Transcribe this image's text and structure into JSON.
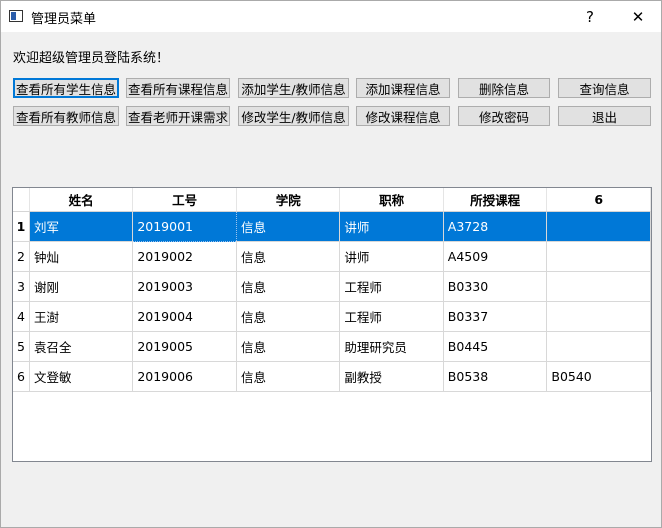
{
  "window": {
    "title": "管理员菜单",
    "help": "?",
    "close": "✕"
  },
  "welcome": "欢迎超级管理员登陆系统！",
  "buttons_row1": [
    "查看所有学生信息",
    "查看所有课程信息",
    "添加学生/教师信息",
    "添加课程信息",
    "删除信息",
    "查询信息"
  ],
  "buttons_row2": [
    "查看所有教师信息",
    "查看老师开课需求",
    "修改学生/教师信息",
    "修改课程信息",
    "修改密码",
    "退出"
  ],
  "table": {
    "headers": [
      "姓名",
      "工号",
      "学院",
      "职称",
      "所授课程",
      "6"
    ],
    "rows": [
      {
        "num": "1",
        "cells": [
          "刘军",
          "2019001",
          "信息",
          "讲师",
          "A3728",
          ""
        ]
      },
      {
        "num": "2",
        "cells": [
          "钟灿",
          "2019002",
          "信息",
          "讲师",
          "A4509",
          ""
        ]
      },
      {
        "num": "3",
        "cells": [
          "谢刚",
          "2019003",
          "信息",
          "工程师",
          "B0330",
          ""
        ]
      },
      {
        "num": "4",
        "cells": [
          "王澍",
          "2019004",
          "信息",
          "工程师",
          "B0337",
          ""
        ]
      },
      {
        "num": "5",
        "cells": [
          "袁召全",
          "2019005",
          "信息",
          "助理研究员",
          "B0445",
          ""
        ]
      },
      {
        "num": "6",
        "cells": [
          "文登敏",
          "2019006",
          "信息",
          "副教授",
          "B0538",
          "B0540"
        ]
      }
    ]
  },
  "colors": {
    "selection": "#0078d7",
    "button": "#e1e1e1",
    "background": "#f0f0f0"
  }
}
